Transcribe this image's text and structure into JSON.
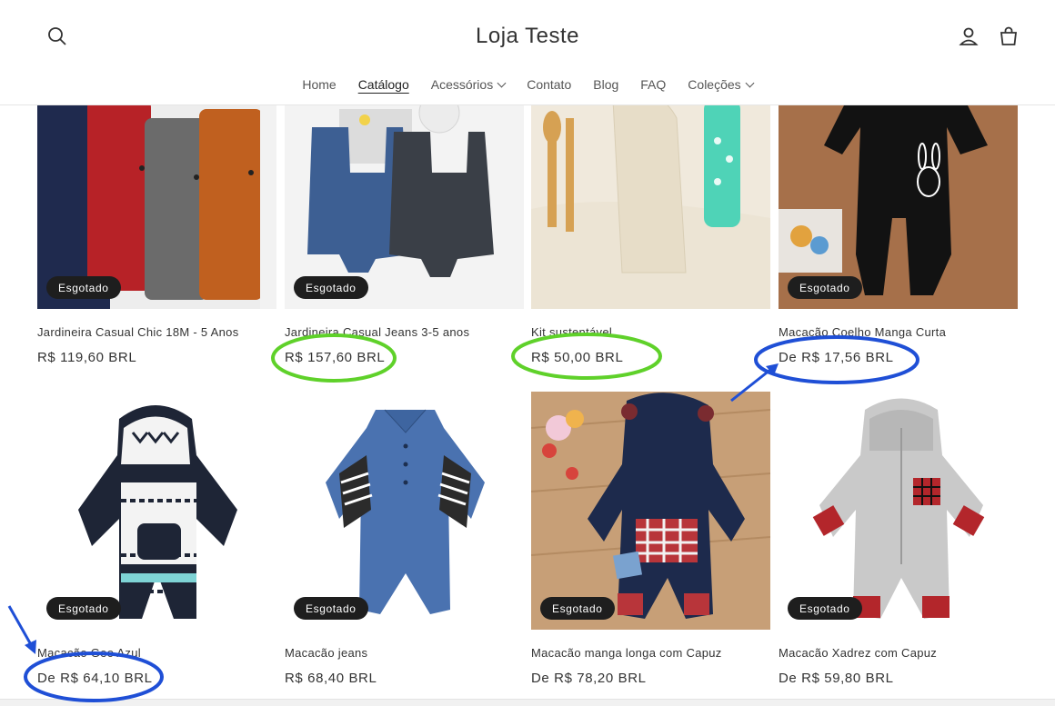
{
  "store": {
    "title": "Loja Teste"
  },
  "nav": {
    "items": [
      {
        "label": "Home",
        "active": false,
        "dropdown": false
      },
      {
        "label": "Catálogo",
        "active": true,
        "dropdown": false
      },
      {
        "label": "Acessórios",
        "active": false,
        "dropdown": true
      },
      {
        "label": "Contato",
        "active": false,
        "dropdown": false
      },
      {
        "label": "Blog",
        "active": false,
        "dropdown": false
      },
      {
        "label": "FAQ",
        "active": false,
        "dropdown": false
      },
      {
        "label": "Coleções",
        "active": false,
        "dropdown": true
      }
    ]
  },
  "icons": {
    "search": "search-icon",
    "account": "user-icon",
    "cart": "cart-icon"
  },
  "products": [
    {
      "title": "Jardineira Casual Chic 18M - 5 Anos",
      "price": "R$ 119,60 BRL",
      "badge": "Esgotado"
    },
    {
      "title": "Jardineira Casual Jeans 3-5 anos",
      "price": "R$ 157,60 BRL",
      "badge": "Esgotado"
    },
    {
      "title": "Kit sustentável",
      "price": "R$ 50,00 BRL",
      "badge": ""
    },
    {
      "title": "Macacão Coelho Manga Curta",
      "price": "De R$ 17,56 BRL",
      "badge": "Esgotado"
    },
    {
      "title": "Macacão Geo Azul",
      "price": "De R$ 64,10 BRL",
      "badge": "Esgotado"
    },
    {
      "title": "Macacão jeans",
      "price": "R$ 68,40 BRL",
      "badge": "Esgotado"
    },
    {
      "title": "Macacão manga longa com Capuz",
      "price": "De R$ 78,20 BRL",
      "badge": "Esgotado"
    },
    {
      "title": "Macacão Xadrez com Capuz",
      "price": "De R$ 59,80 BRL",
      "badge": "Esgotado"
    }
  ],
  "annotations": {
    "green": "#5fd12a",
    "blue": "#1f4fd6"
  }
}
